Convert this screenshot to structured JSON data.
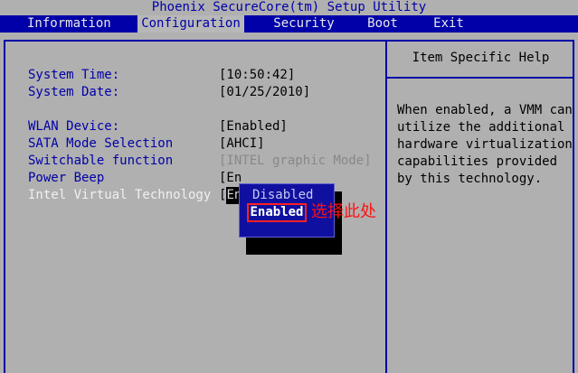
{
  "title": "Phoenix SecureCore(tm) Setup Utility",
  "menu": [
    {
      "label": "Information",
      "active": false
    },
    {
      "label": "Configuration",
      "active": true
    },
    {
      "label": "Security",
      "active": false
    },
    {
      "label": "Boot",
      "active": false
    },
    {
      "label": "Exit",
      "active": false
    }
  ],
  "settings": {
    "system_time": {
      "label": "System Time:",
      "value": "[10:50:42]"
    },
    "system_date": {
      "label": "System Date:",
      "value": "[01/25/2010]"
    },
    "wlan_device": {
      "label": "WLAN Device:",
      "value": "[Enabled]"
    },
    "sata_mode": {
      "label": "SATA Mode Selection",
      "value": "[AHCI]"
    },
    "switchable": {
      "label": "Switchable function",
      "value": "[INTEL graphic Mode]"
    },
    "power_beep": {
      "label": "Power Beep",
      "value": "[En"
    },
    "intel_vt": {
      "label": "Intel Virtual Technology",
      "value_prefix": "[",
      "value_cursor": "En"
    }
  },
  "help": {
    "title": "Item Specific Help",
    "lines": [
      "When enabled, a VMM can",
      "utilize the additional",
      "hardware virtualization",
      "capabilities provided",
      "by this technology."
    ]
  },
  "popup": {
    "options": [
      "Disabled",
      "Enabled"
    ],
    "selected": "Enabled"
  },
  "annotation": "选择此处",
  "colors": {
    "bios_blue": "#0000a8",
    "background": "#b0b0b0",
    "highlight_red": "#ff2020"
  }
}
